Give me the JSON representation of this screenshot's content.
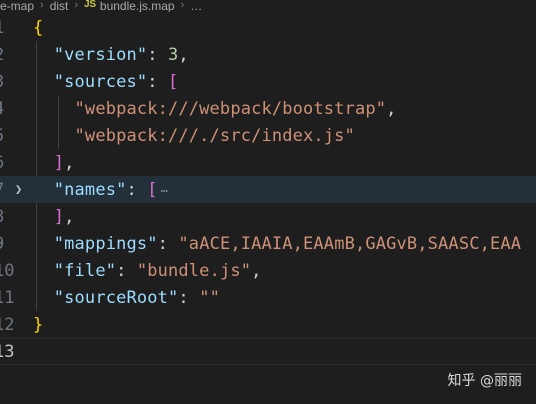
{
  "breadcrumb": {
    "items": [
      "e-map",
      "dist",
      "bundle.js.map",
      "…"
    ],
    "file_badge": "JS"
  },
  "editor": {
    "line_numbers": [
      "1",
      "2",
      "3",
      "4",
      "5",
      "6",
      "7",
      "8",
      "9",
      "10",
      "11",
      "12",
      "13"
    ],
    "lines": {
      "l1_brace_open": "{",
      "l2_key": "\"version\"",
      "l2_colon": ": ",
      "l2_value": "3",
      "l2_comma": ",",
      "l3_key": "\"sources\"",
      "l3_colon": ": ",
      "l3_bracket": "[",
      "l4_value": "\"webpack:///webpack/bootstrap\"",
      "l4_comma": ",",
      "l5_value": "\"webpack:///./src/index.js\"",
      "l6_bracket": "]",
      "l6_comma": ",",
      "l7_key": "\"names\"",
      "l7_colon": ": ",
      "l7_bracket": "[",
      "l7_ellipsis": "…",
      "l8_bracket": "]",
      "l8_comma": ",",
      "l9_key": "\"mappings\"",
      "l9_colon": ": ",
      "l9_value": "\"aACE,IAAIA,EAAmB,GAGvB,SAASC,EAA",
      "l10_key": "\"file\"",
      "l10_colon": ": ",
      "l10_value": "\"bundle.js\"",
      "l10_comma": ",",
      "l11_key": "\"sourceRoot\"",
      "l11_colon": ": ",
      "l11_value": "\"\"",
      "l12_brace_close": "}"
    }
  },
  "watermark": {
    "text": "知乎 @丽丽"
  },
  "colors": {
    "background": "#1e1e1e",
    "key": "#9cdcfe",
    "string": "#ce9178",
    "number": "#b5cea8",
    "brace": "#ffd700",
    "bracket": "#da70d6",
    "highlight_line": "#23303a"
  },
  "icons": {
    "fold": "chevron-right-icon",
    "file": "javascript-file-icon"
  }
}
